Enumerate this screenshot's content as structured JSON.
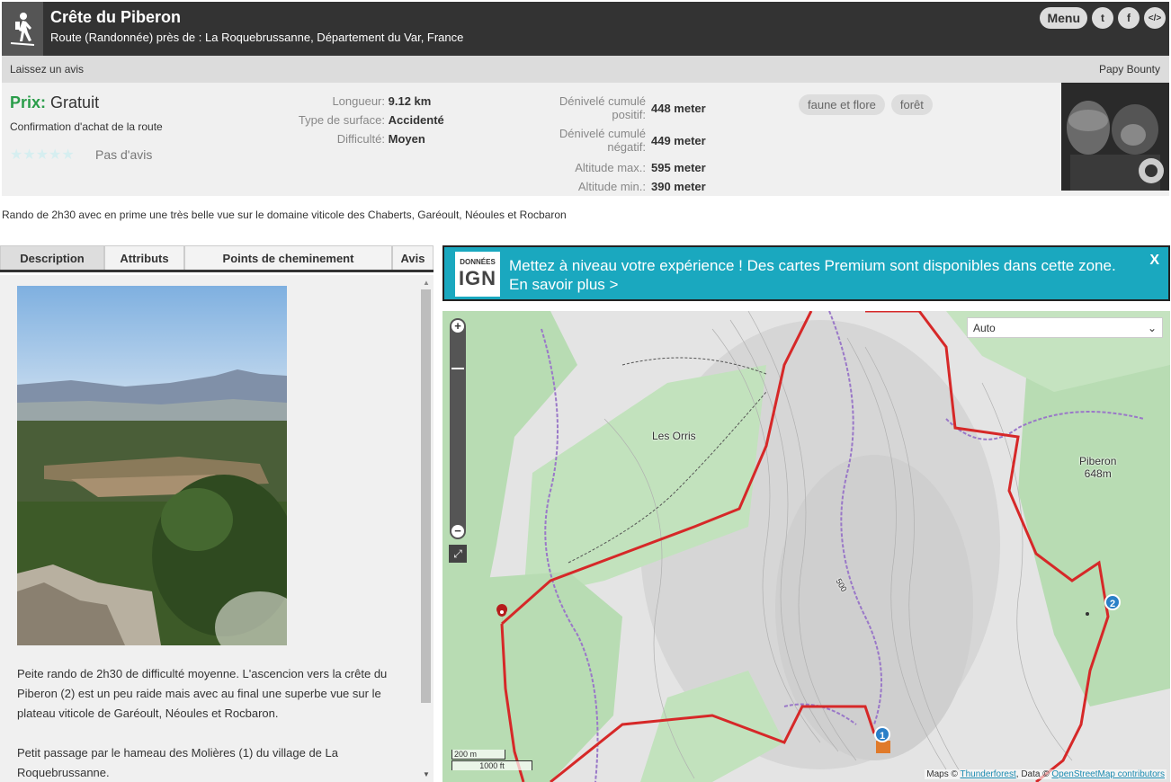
{
  "header": {
    "title": "Crête du Piberon",
    "subtitle": "Route (Randonnée) près de : La Roquebrussanne, Département du Var, France",
    "menu_label": "Menu",
    "twitter_icon": "t",
    "facebook_icon": "f",
    "embed_icon": "</>"
  },
  "subbar": {
    "review_link": "Laissez un avis",
    "author": "Papy Bounty"
  },
  "info": {
    "price_label": "Prix:",
    "price_value": "Gratuit",
    "purchase_confirm": "Confirmation d'achat de la route",
    "stars": "★★★★★",
    "no_reviews": "Pas d'avis",
    "length_label": "Longueur:",
    "length_value": "9.12 km",
    "surface_label": "Type de surface:",
    "surface_value": "Accidenté",
    "difficulty_label": "Difficulté:",
    "difficulty_value": "Moyen",
    "gain_label_1": "Dénivelé cumulé",
    "gain_label_2": "positif:",
    "gain_value": "448 meter",
    "loss_label_1": "Dénivelé cumulé",
    "loss_label_2": "négatif:",
    "loss_value": "449 meter",
    "alt_max_label": "Altitude max.:",
    "alt_max_value": "595 meter",
    "alt_min_label": "Altitude min.:",
    "alt_min_value": "390 meter",
    "tags": [
      "faune et flore",
      "forêt"
    ]
  },
  "summary": "Rando de 2h30 avec en prime une très belle vue sur le domaine viticole des Chaberts, Garéoult, Néoules et Rocbaron",
  "tabs": [
    {
      "label": "Description"
    },
    {
      "label": "Attributs"
    },
    {
      "label": "Points de cheminement"
    },
    {
      "label": "Avis"
    }
  ],
  "description": {
    "paragraph1": "Peite rando de 2h30 de difficulté moyenne. L'ascencion vers la crête du Piberon (2) est un peu raide mais avec au final une superbe vue sur le plateau viticole de Garéoult, Néoules et Rocbaron.",
    "paragraph2": "Petit passage par le hameau des Molières (1) du village de La Roquebrussanne."
  },
  "banner": {
    "logo_top": "DONNÉES",
    "logo_bottom": "IGN",
    "text": "Mettez à niveau votre expérience ! Des cartes Premium sont disponibles dans cette zone. En savoir plus >",
    "close": "X"
  },
  "map": {
    "layer_select": "Auto",
    "label_orris": "Les Orris",
    "label_piberon": "Piberon",
    "label_piberon_alt": "648m",
    "contour_500": "500",
    "scale_m": "200 m",
    "scale_ft": "1000 ft",
    "waypoint_1": "1",
    "waypoint_2": "2",
    "attribution_prefix": "Maps ©",
    "attribution_tf": "Thunderforest",
    "attribution_mid": ", Data ©",
    "attribution_osm": "OpenStreetMap contributors"
  },
  "colors": {
    "route": "#d62828",
    "forest": "#b5dbb0",
    "banner": "#1aa8bf",
    "price_green": "#2a9d4a"
  }
}
